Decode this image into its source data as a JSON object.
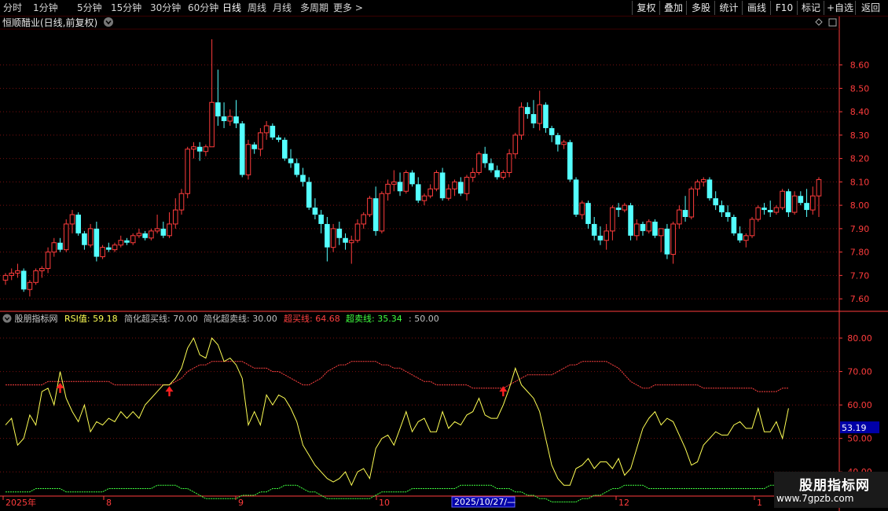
{
  "period_tabs": [
    "分时",
    "1分钟",
    "5分钟",
    "15分钟",
    "30分钟",
    "60分钟",
    "日线",
    "周线",
    "月线",
    "多周期",
    "更多 >"
  ],
  "active_tab": "日线",
  "right_buttons": [
    "复权",
    "叠加",
    "多股",
    "统计",
    "画线",
    "F10",
    "标记",
    "+自选",
    "返回"
  ],
  "kpanel": {
    "title": "恒顺醋业(日线,前复权)"
  },
  "indicator": {
    "name": "股朋指标网",
    "rsi_label": "RSI值: 59.18",
    "simp_overbought": "简化超买线: 70.00",
    "simp_oversold": "简化超卖线: 30.00",
    "overbought": "超买线: 64.68",
    "oversold": "超卖线: 35.34",
    "mid": ": 50.00",
    "last_value": "53.19"
  },
  "colors": {
    "up": "#ff3c3c",
    "down": "#54ffff",
    "rsi": "#ffff54",
    "ob": "#ff4040",
    "os": "#40ff40",
    "grid": "#7a1010",
    "axis": "#ff3c3c"
  },
  "watermark": {
    "name": "股朋指标网",
    "url": "www.7gpzb.com"
  },
  "chart_data": [
    {
      "type": "candlestick",
      "title": "恒顺醋业(日线,前复权)",
      "ylim": [
        7.55,
        8.75
      ],
      "y_ticks": [
        "8.60",
        "8.50",
        "8.40",
        "8.30",
        "8.20",
        "8.10",
        "8.00",
        "7.90",
        "7.80",
        "7.70",
        "7.60"
      ],
      "x_ticks": [
        "2025年",
        "8",
        "9",
        "10",
        "11",
        "12",
        "1"
      ],
      "cursor_date": "2025/10/27/—",
      "ohlc": [
        [
          7.68,
          7.71,
          7.66,
          7.7
        ],
        [
          7.7,
          7.73,
          7.68,
          7.71
        ],
        [
          7.71,
          7.75,
          7.69,
          7.72
        ],
        [
          7.72,
          7.73,
          7.63,
          7.64
        ],
        [
          7.64,
          7.68,
          7.61,
          7.67
        ],
        [
          7.67,
          7.73,
          7.66,
          7.72
        ],
        [
          7.72,
          7.74,
          7.69,
          7.73
        ],
        [
          7.73,
          7.82,
          7.71,
          7.8
        ],
        [
          7.8,
          7.86,
          7.78,
          7.84
        ],
        [
          7.84,
          7.86,
          7.8,
          7.81
        ],
        [
          7.81,
          7.94,
          7.8,
          7.92
        ],
        [
          7.92,
          7.98,
          7.88,
          7.96
        ],
        [
          7.96,
          7.97,
          7.87,
          7.88
        ],
        [
          7.88,
          7.89,
          7.81,
          7.83
        ],
        [
          7.83,
          7.92,
          7.82,
          7.9
        ],
        [
          7.9,
          7.93,
          7.76,
          7.78
        ],
        [
          7.78,
          7.83,
          7.77,
          7.82
        ],
        [
          7.82,
          7.84,
          7.8,
          7.81
        ],
        [
          7.81,
          7.84,
          7.8,
          7.83
        ],
        [
          7.83,
          7.87,
          7.82,
          7.85
        ],
        [
          7.85,
          7.86,
          7.83,
          7.84
        ],
        [
          7.84,
          7.88,
          7.83,
          7.87
        ],
        [
          7.87,
          7.9,
          7.86,
          7.88
        ],
        [
          7.88,
          7.89,
          7.85,
          7.86
        ],
        [
          7.86,
          7.9,
          7.85,
          7.89
        ],
        [
          7.89,
          7.96,
          7.88,
          7.9
        ],
        [
          7.9,
          7.93,
          7.86,
          7.87
        ],
        [
          7.87,
          7.97,
          7.86,
          7.92
        ],
        [
          7.92,
          8.03,
          7.9,
          7.98
        ],
        [
          7.98,
          8.07,
          7.96,
          8.05
        ],
        [
          8.05,
          8.25,
          8.03,
          8.24
        ],
        [
          8.24,
          8.27,
          8.2,
          8.25
        ],
        [
          8.25,
          8.27,
          8.19,
          8.23
        ],
        [
          8.23,
          8.26,
          8.21,
          8.25
        ],
        [
          8.25,
          8.71,
          8.34,
          8.44
        ],
        [
          8.44,
          8.58,
          8.34,
          8.38
        ],
        [
          8.38,
          8.44,
          8.33,
          8.36
        ],
        [
          8.36,
          8.41,
          8.34,
          8.38
        ],
        [
          8.38,
          8.45,
          8.33,
          8.35
        ],
        [
          8.35,
          8.36,
          8.12,
          8.13
        ],
        [
          8.13,
          8.28,
          8.11,
          8.26
        ],
        [
          8.26,
          8.27,
          8.22,
          8.24
        ],
        [
          8.24,
          8.33,
          8.21,
          8.31
        ],
        [
          8.31,
          8.36,
          8.28,
          8.34
        ],
        [
          8.34,
          8.35,
          8.28,
          8.29
        ],
        [
          8.29,
          8.3,
          8.27,
          8.28
        ],
        [
          8.28,
          8.29,
          8.19,
          8.2
        ],
        [
          8.2,
          8.24,
          8.16,
          8.18
        ],
        [
          8.18,
          8.2,
          8.12,
          8.13
        ],
        [
          8.13,
          8.16,
          8.08,
          8.1
        ],
        [
          8.1,
          8.12,
          7.98,
          7.99
        ],
        [
          7.99,
          8.03,
          7.94,
          7.96
        ],
        [
          7.96,
          7.98,
          7.88,
          7.92
        ],
        [
          7.92,
          7.95,
          7.76,
          7.82
        ],
        [
          7.82,
          7.92,
          7.8,
          7.9
        ],
        [
          7.9,
          7.93,
          7.83,
          7.86
        ],
        [
          7.86,
          7.88,
          7.81,
          7.84
        ],
        [
          7.84,
          7.87,
          7.75,
          7.85
        ],
        [
          7.85,
          7.94,
          7.84,
          7.92
        ],
        [
          7.92,
          7.97,
          7.9,
          7.96
        ],
        [
          7.96,
          8.04,
          7.95,
          8.03
        ],
        [
          8.03,
          8.08,
          7.87,
          7.89
        ],
        [
          7.89,
          8.06,
          7.88,
          8.05
        ],
        [
          8.05,
          8.11,
          8.02,
          8.09
        ],
        [
          8.09,
          8.15,
          8.06,
          8.1
        ],
        [
          8.1,
          8.14,
          8.04,
          8.06
        ],
        [
          8.06,
          8.15,
          8.05,
          8.14
        ],
        [
          8.14,
          8.15,
          8.08,
          8.09
        ],
        [
          8.09,
          8.12,
          8.01,
          8.02
        ],
        [
          8.02,
          8.05,
          8.0,
          8.04
        ],
        [
          8.04,
          8.09,
          8.03,
          8.07
        ],
        [
          8.07,
          8.15,
          8.06,
          8.14
        ],
        [
          8.14,
          8.16,
          8.02,
          8.03
        ],
        [
          8.03,
          8.09,
          8.02,
          8.07
        ],
        [
          8.07,
          8.11,
          8.04,
          8.1
        ],
        [
          8.1,
          8.12,
          8.04,
          8.05
        ],
        [
          8.05,
          8.13,
          8.02,
          8.12
        ],
        [
          8.12,
          8.16,
          8.1,
          8.14
        ],
        [
          8.14,
          8.23,
          8.13,
          8.22
        ],
        [
          8.22,
          8.25,
          8.16,
          8.18
        ],
        [
          8.18,
          8.2,
          8.14,
          8.15
        ],
        [
          8.15,
          8.17,
          8.11,
          8.12
        ],
        [
          8.12,
          8.15,
          8.11,
          8.14
        ],
        [
          8.14,
          8.24,
          8.12,
          8.22
        ],
        [
          8.22,
          8.31,
          8.2,
          8.3
        ],
        [
          8.3,
          8.44,
          8.28,
          8.42
        ],
        [
          8.42,
          8.44,
          8.37,
          8.39
        ],
        [
          8.39,
          8.45,
          8.33,
          8.35
        ],
        [
          8.35,
          8.49,
          8.32,
          8.43
        ],
        [
          8.43,
          8.44,
          8.31,
          8.33
        ],
        [
          8.33,
          8.34,
          8.27,
          8.3
        ],
        [
          8.3,
          8.31,
          8.23,
          8.26
        ],
        [
          8.26,
          8.28,
          8.24,
          8.27
        ],
        [
          8.27,
          8.28,
          8.1,
          8.11
        ],
        [
          8.11,
          8.12,
          7.95,
          7.96
        ],
        [
          7.96,
          8.02,
          7.94,
          8.01
        ],
        [
          8.01,
          8.02,
          7.9,
          7.92
        ],
        [
          7.92,
          7.95,
          7.85,
          7.87
        ],
        [
          7.87,
          7.91,
          7.83,
          7.85
        ],
        [
          7.85,
          7.92,
          7.81,
          7.89
        ],
        [
          7.89,
          8.0,
          7.85,
          7.99
        ],
        [
          7.99,
          8.01,
          7.95,
          7.98
        ],
        [
          7.98,
          8.01,
          7.97,
          8.0
        ],
        [
          8.0,
          8.01,
          7.85,
          7.87
        ],
        [
          7.87,
          7.94,
          7.85,
          7.92
        ],
        [
          7.92,
          7.93,
          7.87,
          7.89
        ],
        [
          7.89,
          7.94,
          7.88,
          7.93
        ],
        [
          7.93,
          7.94,
          7.86,
          7.87
        ],
        [
          7.87,
          7.9,
          7.8,
          7.9
        ],
        [
          7.9,
          7.92,
          7.77,
          7.79
        ],
        [
          7.79,
          7.93,
          7.75,
          7.92
        ],
        [
          7.92,
          8.0,
          7.9,
          7.98
        ],
        [
          7.98,
          8.04,
          7.93,
          7.95
        ],
        [
          7.95,
          8.08,
          7.94,
          8.07
        ],
        [
          8.07,
          8.11,
          8.04,
          8.1
        ],
        [
          8.1,
          8.12,
          8.08,
          8.11
        ],
        [
          8.11,
          8.12,
          8.02,
          8.03
        ],
        [
          8.03,
          8.06,
          7.98,
          8.0
        ],
        [
          8.0,
          8.02,
          7.95,
          7.97
        ],
        [
          7.97,
          8.0,
          7.93,
          7.95
        ],
        [
          7.95,
          7.96,
          7.87,
          7.88
        ],
        [
          7.88,
          7.91,
          7.84,
          7.85
        ],
        [
          7.85,
          7.88,
          7.82,
          7.87
        ],
        [
          7.87,
          7.95,
          7.86,
          7.94
        ],
        [
          7.94,
          8.0,
          7.93,
          7.99
        ],
        [
          7.99,
          8.01,
          7.96,
          7.98
        ],
        [
          7.98,
          8.02,
          7.95,
          7.97
        ],
        [
          7.97,
          8.0,
          7.96,
          7.99
        ],
        [
          7.99,
          8.07,
          7.98,
          8.06
        ],
        [
          8.06,
          8.07,
          7.95,
          7.97
        ],
        [
          7.97,
          8.06,
          7.96,
          8.04
        ],
        [
          8.04,
          8.06,
          8.0,
          8.01
        ],
        [
          8.01,
          8.07,
          7.95,
          7.98
        ],
        [
          7.98,
          8.08,
          7.96,
          8.04
        ],
        [
          8.04,
          8.12,
          7.95,
          8.11
        ]
      ]
    },
    {
      "type": "line",
      "title": "股朋指标网",
      "ylim": [
        33,
        84
      ],
      "y_ticks": [
        "80.00",
        "70.00",
        "60.00",
        "50.00",
        "40.00"
      ],
      "series": [
        {
          "name": "RSI值",
          "values": [
            54,
            56,
            48,
            50,
            57,
            54,
            64,
            65,
            60,
            70,
            62,
            58,
            55,
            60,
            52,
            55,
            54,
            56,
            55,
            58,
            56,
            58,
            56,
            60,
            62,
            64,
            66,
            66,
            68,
            71,
            77,
            80,
            75,
            74,
            80,
            78,
            73,
            74,
            72,
            68,
            54,
            58,
            54,
            63,
            60,
            63,
            62,
            59,
            55,
            48,
            45,
            42,
            40,
            38,
            37,
            38,
            40,
            36,
            40,
            41,
            38,
            47,
            50,
            51,
            48,
            53,
            58,
            52,
            55,
            56,
            52,
            52,
            58,
            53,
            55,
            54,
            57,
            58,
            62,
            57,
            56,
            56,
            60,
            65,
            71,
            66,
            64,
            62,
            58,
            50,
            42,
            38,
            36,
            36,
            41,
            42,
            44,
            41,
            43,
            43,
            41,
            44,
            39,
            41,
            47,
            53,
            56,
            58,
            54,
            56,
            55,
            51,
            47,
            42,
            43,
            48,
            50,
            52,
            51,
            51,
            54,
            55,
            53,
            53,
            59,
            52,
            52,
            55,
            50,
            59
          ]
        },
        {
          "name": "超买线",
          "values": [
            66,
            66,
            66,
            66,
            66,
            66,
            66,
            67,
            67,
            67,
            67,
            67,
            67,
            67,
            67,
            67,
            67,
            67,
            66,
            66,
            66,
            66,
            66,
            66,
            66,
            66,
            66,
            66,
            67,
            68,
            70,
            71,
            72,
            72,
            73,
            73,
            73,
            73,
            73,
            73,
            72,
            71,
            71,
            71,
            70,
            70,
            69,
            68,
            67,
            66,
            66,
            67,
            68,
            70,
            71,
            72,
            72,
            73,
            73,
            73,
            73,
            73,
            72,
            72,
            71,
            71,
            70,
            69,
            68,
            67,
            67,
            66,
            66,
            66,
            66,
            66,
            66,
            65,
            65,
            65,
            65,
            65,
            65,
            66,
            67,
            68,
            69,
            69,
            69,
            69,
            69,
            70,
            71,
            72,
            72,
            73,
            73,
            73,
            73,
            73,
            72,
            71,
            69,
            67,
            66,
            65,
            65,
            66,
            66,
            66,
            66,
            66,
            66,
            66,
            66,
            65,
            65,
            65,
            65,
            65,
            65,
            65,
            65,
            65,
            64,
            64,
            64,
            64,
            65,
            65
          ]
        },
        {
          "name": "超卖线",
          "values": [
            34,
            34,
            34,
            34,
            34,
            35,
            35,
            35,
            35,
            35,
            34,
            34,
            34,
            34,
            34,
            34,
            34,
            35,
            35,
            35,
            35,
            35,
            35,
            35,
            35,
            36,
            36,
            36,
            36,
            35,
            35,
            34,
            33,
            32,
            32,
            32,
            32,
            32,
            32,
            33,
            33,
            33,
            34,
            34,
            35,
            35,
            36,
            36,
            36,
            35,
            34,
            34,
            33,
            32,
            32,
            32,
            32,
            32,
            32,
            32,
            32,
            33,
            34,
            34,
            34,
            34,
            34,
            35,
            35,
            35,
            35,
            35,
            35,
            35,
            35,
            36,
            36,
            36,
            36,
            36,
            36,
            35,
            35,
            35,
            34,
            34,
            33,
            33,
            32,
            32,
            31,
            31,
            31,
            31,
            31,
            32,
            32,
            33,
            33,
            34,
            35,
            35,
            36,
            36,
            36,
            36,
            35,
            35,
            35,
            35,
            35,
            35,
            35,
            35,
            35,
            35,
            35,
            35,
            35,
            35,
            35,
            35,
            35,
            35,
            35,
            35,
            36,
            36,
            36,
            36
          ]
        }
      ],
      "signals": [
        {
          "type": "up-arrow",
          "index": 9,
          "value": 65
        },
        {
          "type": "up-arrow",
          "index": 27,
          "value": 64
        },
        {
          "type": "up-arrow",
          "index": 82,
          "value": 64
        }
      ]
    }
  ]
}
